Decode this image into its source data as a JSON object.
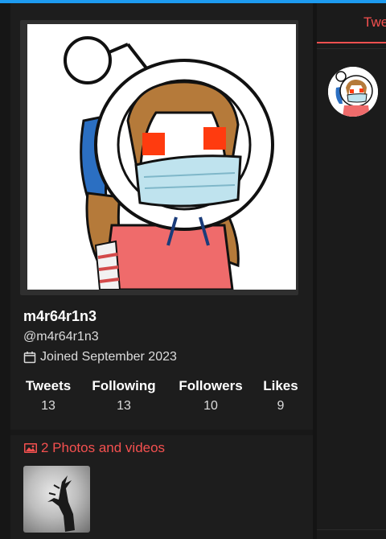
{
  "profile": {
    "display_name": "m4r64r1n3",
    "handle": "@m4r64r1n3",
    "joined": "Joined September 2023"
  },
  "stats": [
    {
      "label": "Tweets",
      "value": "13"
    },
    {
      "label": "Following",
      "value": "13"
    },
    {
      "label": "Followers",
      "value": "10"
    },
    {
      "label": "Likes",
      "value": "9"
    }
  ],
  "media": {
    "heading": "2 Photos and videos"
  },
  "tabs": {
    "active_label": "Twe"
  },
  "colors": {
    "accent": "#f4504f",
    "top_bar": "#1d9bf0",
    "background": "#181818",
    "card": "#1d1d1d"
  },
  "icons": {
    "calendar": "calendar-icon",
    "photo": "image-icon"
  }
}
